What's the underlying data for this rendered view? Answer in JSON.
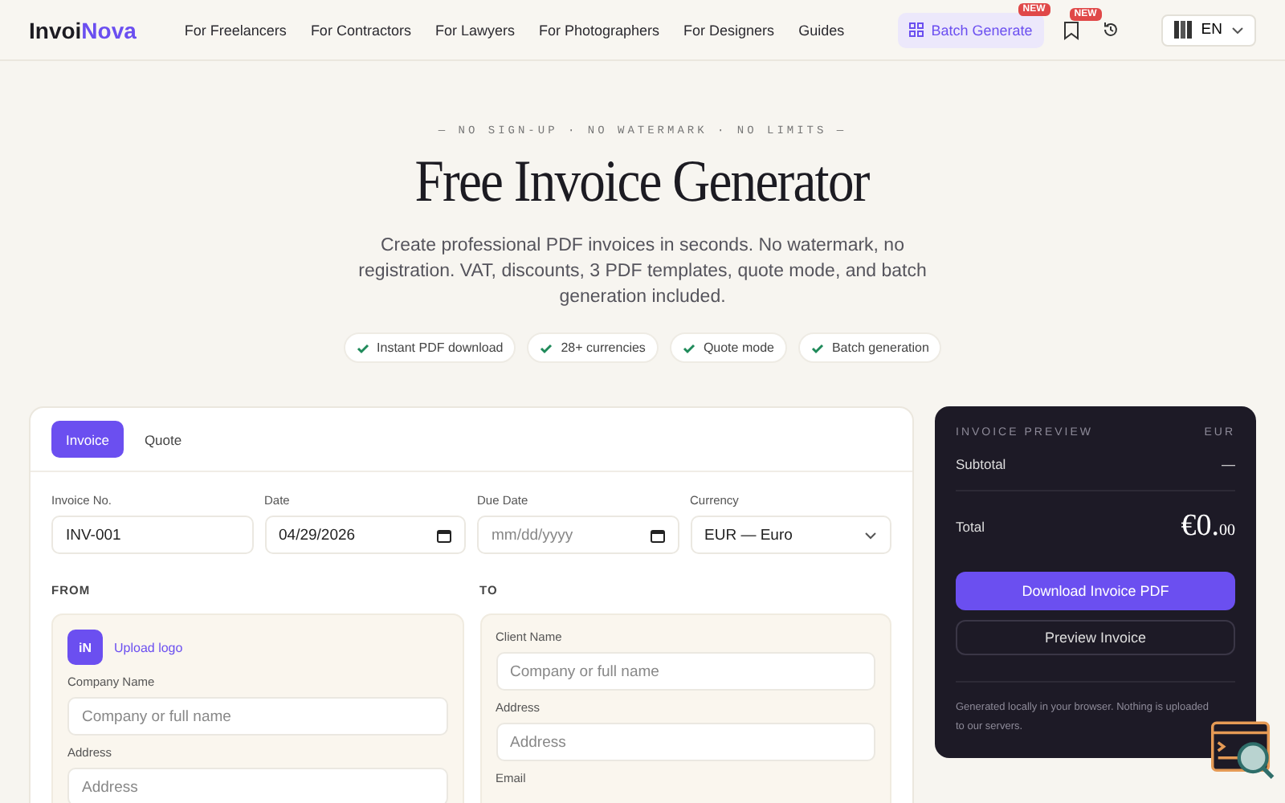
{
  "logo": {
    "text": "Invoi",
    "accent": "Nova"
  },
  "nav": [
    "For Freelancers",
    "For Contractors",
    "For Lawyers",
    "For Photographers",
    "For Designers",
    "Guides"
  ],
  "header_actions": {
    "batch": {
      "label": "Batch Generate",
      "badge": "NEW"
    },
    "bookmark_badge": "NEW",
    "language": "EN"
  },
  "hero": {
    "tagline": "— NO SIGN-UP · NO WATERMARK · NO LIMITS —",
    "title": "Free Invoice Generator",
    "subtitle": "Create professional PDF invoices in seconds. No watermark, no registration. VAT, discounts, 3 PDF templates, quote mode, and batch generation included.",
    "features": [
      "Instant PDF download",
      "28+ currencies",
      "Quote mode",
      "Batch generation"
    ]
  },
  "tabs": [
    {
      "label": "Invoice",
      "selected": true
    },
    {
      "label": "Quote",
      "selected": false
    }
  ],
  "meta_fields": [
    {
      "kind": "text",
      "label": "Invoice No.",
      "value": "INV-001"
    },
    {
      "kind": "date",
      "label": "Date",
      "value": "04/29/2026"
    },
    {
      "kind": "date",
      "label": "Due Date",
      "placeholder": "mm/dd/yyyy"
    },
    {
      "kind": "select",
      "label": "Currency",
      "value": "EUR — Euro"
    }
  ],
  "from": {
    "heading": "FROM",
    "logo_mark": "iN",
    "upload": "Upload logo",
    "fields": [
      {
        "label": "Company Name",
        "placeholder": "Company or full name"
      },
      {
        "label": "Address",
        "placeholder": "Address"
      }
    ]
  },
  "to": {
    "heading": "TO",
    "fields": [
      {
        "label": "Client Name",
        "placeholder": "Company or full name"
      },
      {
        "label": "Address",
        "placeholder": "Address"
      },
      {
        "label": "Email"
      }
    ]
  },
  "preview": {
    "title": "INVOICE PREVIEW",
    "currency": "EUR",
    "subtotal_label": "Subtotal",
    "subtotal": "—",
    "total_label": "Total",
    "total_main": "€0.",
    "total_cents": "00",
    "download": "Download Invoice PDF",
    "preview_button": "Preview Invoice",
    "note": "Generated locally in your browser. Nothing is uploaded to our servers."
  }
}
